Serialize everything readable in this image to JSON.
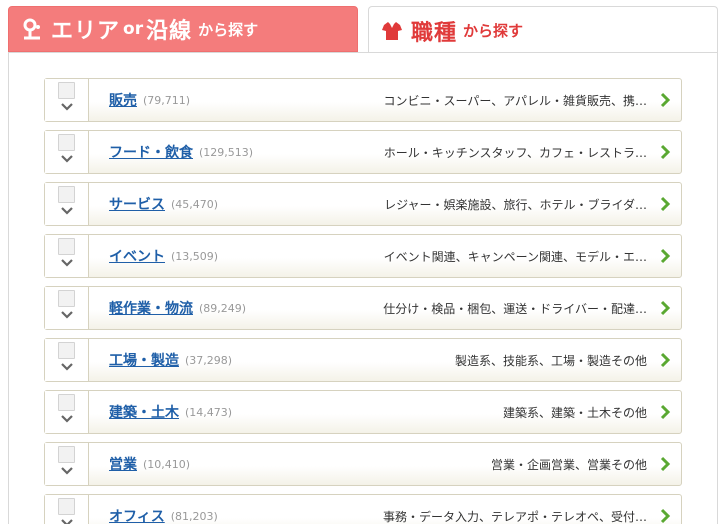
{
  "tabs": {
    "area": {
      "main": "エリア",
      "or": "or",
      "main2": "沿線",
      "sub": "から探す"
    },
    "job": {
      "main": "職種",
      "sub": "から探す"
    }
  },
  "categories": [
    {
      "title": "販売",
      "count": "(79,711)",
      "desc": "コンビニ・スーパー、アパレル・雑貨販売、携…"
    },
    {
      "title": "フード・飲食",
      "count": "(129,513)",
      "desc": "ホール・キッチンスタッフ、カフェ・レストラ…"
    },
    {
      "title": "サービス",
      "count": "(45,470)",
      "desc": "レジャー・娯楽施設、旅行、ホテル・ブライダ…"
    },
    {
      "title": "イベント",
      "count": "(13,509)",
      "desc": "イベント関連、キャンペーン関連、モデル・エ…"
    },
    {
      "title": "軽作業・物流",
      "count": "(89,249)",
      "desc": "仕分け・検品・梱包、運送・ドライバー・配達…"
    },
    {
      "title": "工場・製造",
      "count": "(37,298)",
      "desc": "製造系、技能系、工場・製造その他"
    },
    {
      "title": "建築・土木",
      "count": "(14,473)",
      "desc": "建築系、建築・土木その他"
    },
    {
      "title": "営業",
      "count": "(10,410)",
      "desc": "営業・企画営業、営業その他"
    },
    {
      "title": "オフィス",
      "count": "(81,203)",
      "desc": "事務・データ入力、テレアポ・テレオペ、受付…"
    }
  ],
  "colors": {
    "accent_red": "#f47c7c",
    "link_blue": "#1f5fa8",
    "chevron_green": "#5aa832"
  },
  "icons": {
    "area_tab": "location-pin-icon",
    "job_tab": "uniform-shirt-icon",
    "row_toggle": "chevron-down-icon",
    "row_go": "chevron-right-icon"
  }
}
